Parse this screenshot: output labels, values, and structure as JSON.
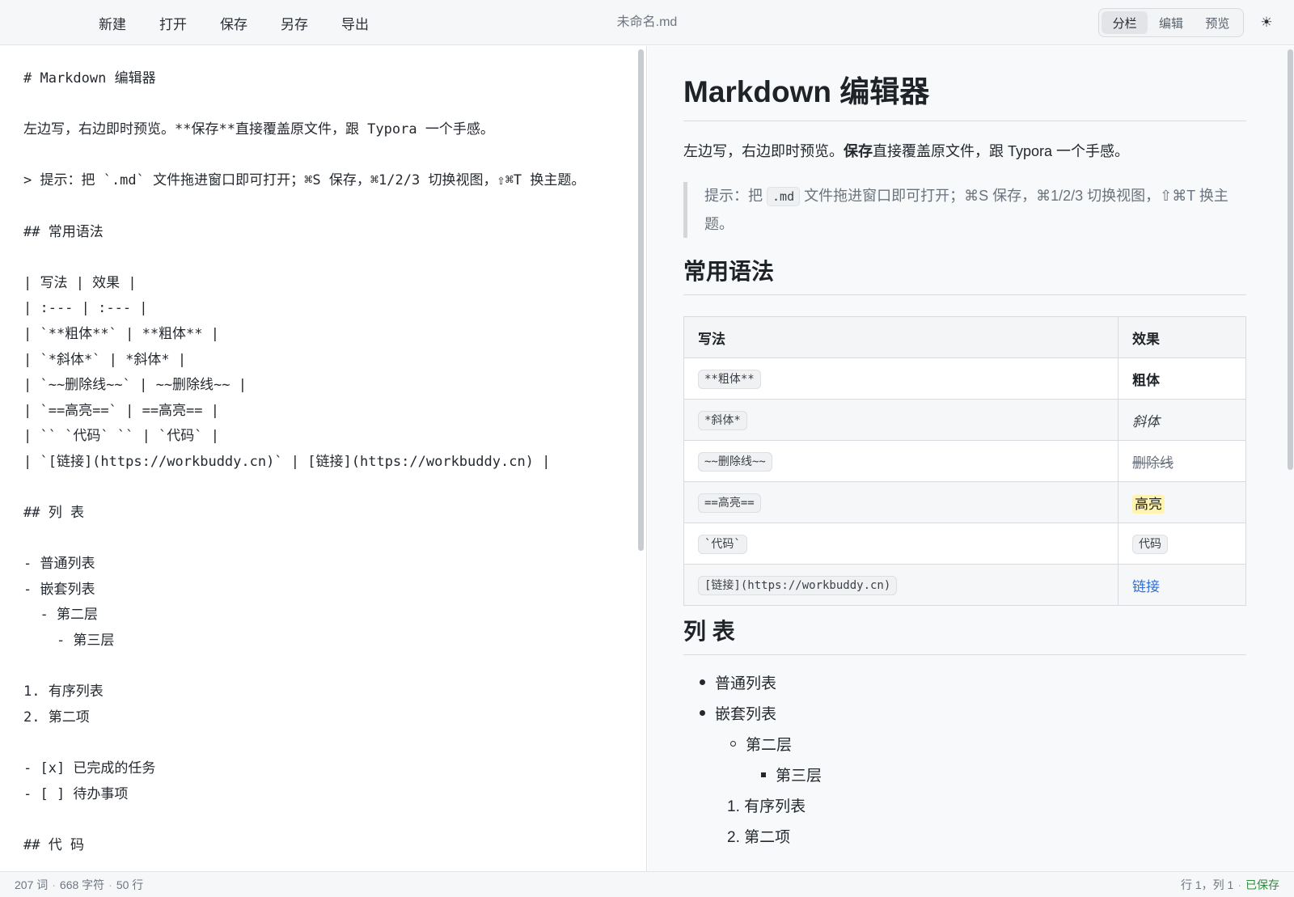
{
  "toolbar": {
    "menu": [
      "新建",
      "打开",
      "保存",
      "另存",
      "导出"
    ],
    "doc_title": "未命名.md",
    "views": [
      "分栏",
      "编辑",
      "预览"
    ],
    "active_view": 0,
    "theme_icon": "☀"
  },
  "editor": {
    "lines": [
      "# Markdown 编辑器",
      "",
      "左边写，右边即时预览。**保存**直接覆盖原文件，跟 Typora 一个手感。",
      "",
      "> 提示：把 `.md` 文件拖进窗口即可打开；⌘S 保存，⌘1/2/3 切换视图，⇧⌘T 换主题。",
      "",
      "## 常用语法",
      "",
      "| 写法 | 效果 |",
      "| :--- | :--- |",
      "| `**粗体**` | **粗体** |",
      "| `*斜体*` | *斜体* |",
      "| `~~删除线~~` | ~~删除线~~ |",
      "| `==高亮==` | ==高亮== |",
      "| `` `代码` `` | `代码` |",
      "| `[链接](https://workbuddy.cn)` | [链接](https://workbuddy.cn) |",
      "",
      "## 列 表",
      "",
      "- 普通列表",
      "- 嵌套列表",
      "  - 第二层",
      "    - 第三层",
      "",
      "1. 有序列表",
      "2. 第二项",
      "",
      "- [x] 已完成的任务",
      "- [ ] 待办事项",
      "",
      "## 代 码"
    ]
  },
  "preview": {
    "h1": "Markdown 编辑器",
    "intro": {
      "before": "左边写，右边即时预览。",
      "bold": "保存",
      "after": "直接覆盖原文件，跟 Typora 一个手感。"
    },
    "quote": {
      "before": "提示：把",
      "code": ".md",
      "after": "文件拖进窗口即可打开；⌘S 保存，⌘1/2/3 切换视图，⇧⌘T 换主题。"
    },
    "h2_syntax": "常用语法",
    "table": {
      "headers": [
        "写法",
        "效果"
      ],
      "rows": [
        {
          "code": "**粗体**",
          "effect": "粗体",
          "style": "bold"
        },
        {
          "code": "*斜体*",
          "effect": "斜体",
          "style": "italic"
        },
        {
          "code": "~~删除线~~",
          "effect": "删除线",
          "style": "del"
        },
        {
          "code": "==高亮==",
          "effect": "高亮",
          "style": "mark"
        },
        {
          "code": "`代码`",
          "effect": "代码",
          "style": "code"
        },
        {
          "code": "[链接](https://workbuddy.cn)",
          "effect": "链接",
          "style": "link"
        }
      ]
    },
    "h2_list": "列 表",
    "list": {
      "item1": "普通列表",
      "item2": "嵌套列表",
      "level2": "第二层",
      "level3": "第三层",
      "ordered1": "有序列表",
      "ordered2": "第二项",
      "ordered1_num": "1.",
      "ordered2_num": "2."
    }
  },
  "status": {
    "words": "207 词",
    "chars": "668 字符",
    "lines": "50 行",
    "cursor": "行 1，列 1",
    "saved": "已保存"
  },
  "colors": {
    "accent_link": "#2f6fd6",
    "saved_green": "#2e8b3e",
    "highlight": "#fff3b0"
  }
}
